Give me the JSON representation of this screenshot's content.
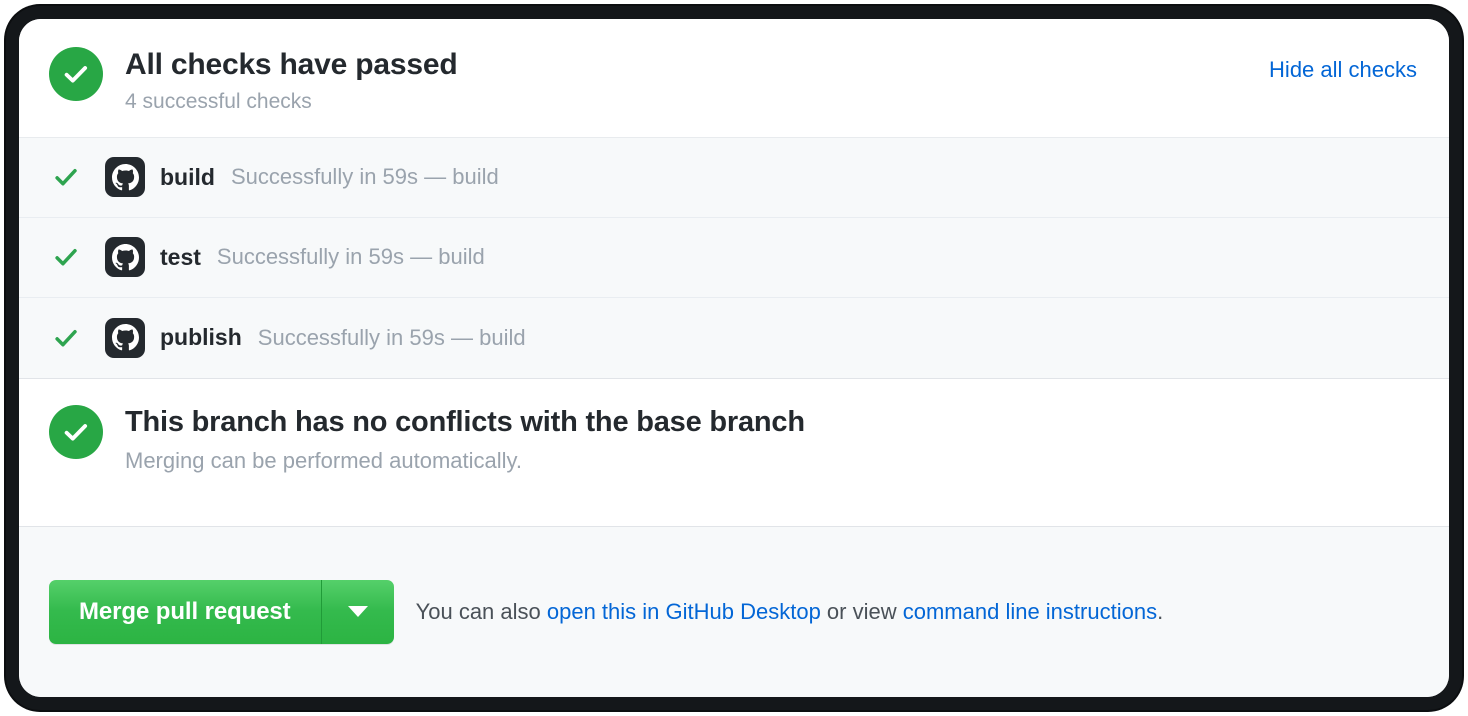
{
  "checks_header": {
    "status_icon": "check-circle-icon",
    "title": "All checks have passed",
    "subtitle": "4 successful checks",
    "hide_link": "Hide all checks"
  },
  "checks": [
    {
      "status_icon": "check-icon",
      "avatar_icon": "github-octocat-icon",
      "name": "build",
      "description": "Successfully in 59s — build"
    },
    {
      "status_icon": "check-icon",
      "avatar_icon": "github-octocat-icon",
      "name": "test",
      "description": "Successfully in 59s — build"
    },
    {
      "status_icon": "check-icon",
      "avatar_icon": "github-octocat-icon",
      "name": "publish",
      "description": "Successfully in 59s — build"
    }
  ],
  "conflicts": {
    "status_icon": "check-circle-icon",
    "title": "This branch has no conflicts with the base branch",
    "subtitle": "Merging can be performed automatically."
  },
  "merge_bar": {
    "merge_label": "Merge pull request",
    "caret_icon": "chevron-down-icon",
    "note_prefix": "You can also ",
    "desktop_link": "open this in GitHub Desktop",
    "note_middle": " or view ",
    "cli_link": "command line instructions",
    "note_suffix": "."
  },
  "colors": {
    "success_green": "#28a745",
    "merge_button_green": "#34ba4d",
    "link_blue": "#0366d6",
    "text_dark": "#24292e",
    "text_muted": "#9aa3ad",
    "row_background": "#f7f9fa",
    "frame_dark": "#14171a"
  }
}
